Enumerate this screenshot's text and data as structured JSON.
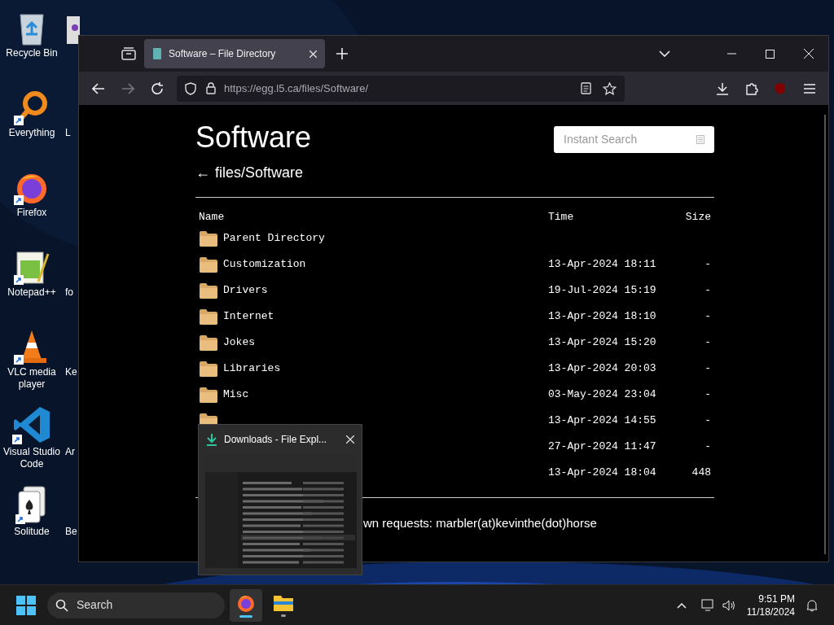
{
  "desktop": {
    "icons": [
      {
        "label": "Recycle Bin"
      },
      {
        "label": "Everything"
      },
      {
        "label": "Firefox"
      },
      {
        "label": "Notepad++"
      },
      {
        "label": "VLC media player"
      },
      {
        "label": "Visual Studio Code"
      },
      {
        "label": "Solitude"
      }
    ],
    "column_2": [
      {
        "kind": "icon"
      },
      {
        "kind": "label",
        "label": "L"
      },
      {
        "kind": "hidden"
      },
      {
        "kind": "label",
        "label": "fo"
      },
      {
        "kind": "label",
        "label": "Ke"
      },
      {
        "kind": "label",
        "label": "Ar"
      },
      {
        "kind": "label",
        "label": "Be"
      }
    ]
  },
  "browser": {
    "tabs": [
      {
        "title": "Software – File Directory",
        "selected": true
      }
    ],
    "url": "https://egg.l5.ca/files/Software/"
  },
  "page": {
    "title": "Software",
    "search": {
      "placeholder": "Instant Search"
    },
    "breadcrumb": {
      "arrow": "←",
      "path": "files/Software"
    },
    "table": {
      "columns": [
        "Name",
        "Time",
        "Size"
      ],
      "rows": [
        {
          "kind": "folder",
          "name": "Parent Directory"
        },
        {
          "kind": "folder",
          "name": "Customization",
          "time": "13-Apr-2024 18:11",
          "size": "-"
        },
        {
          "kind": "folder",
          "name": "Drivers",
          "time": "19-Jul-2024 15:19",
          "size": "-"
        },
        {
          "kind": "folder",
          "name": "Internet",
          "time": "13-Apr-2024 18:10",
          "size": "-"
        },
        {
          "kind": "folder",
          "name": "Jokes",
          "time": "13-Apr-2024 15:20",
          "size": "-"
        },
        {
          "kind": "folder",
          "name": "Libraries",
          "time": "13-Apr-2024 20:03",
          "size": "-"
        },
        {
          "kind": "folder",
          "name": "Misc",
          "time": "03-May-2024 23:04",
          "size": "-"
        },
        {
          "kind": "folder",
          "time": "13-Apr-2024 14:55",
          "size": "-"
        },
        {
          "kind": "hidden",
          "time": "27-Apr-2024 11:47",
          "size": "-"
        },
        {
          "kind": "hidden",
          "time": "13-Apr-2024 18:04",
          "size": "448"
        }
      ]
    },
    "footer": "wn requests: marbler(at)kevinthe(dot)horse"
  },
  "preview": {
    "title": "Downloads - File Expl..."
  },
  "taskbar": {
    "search": "Search",
    "apps": [
      {
        "selected": true
      },
      {
        "selected": false
      }
    ],
    "time": "9:51 PM",
    "date": "11/18/2024"
  }
}
